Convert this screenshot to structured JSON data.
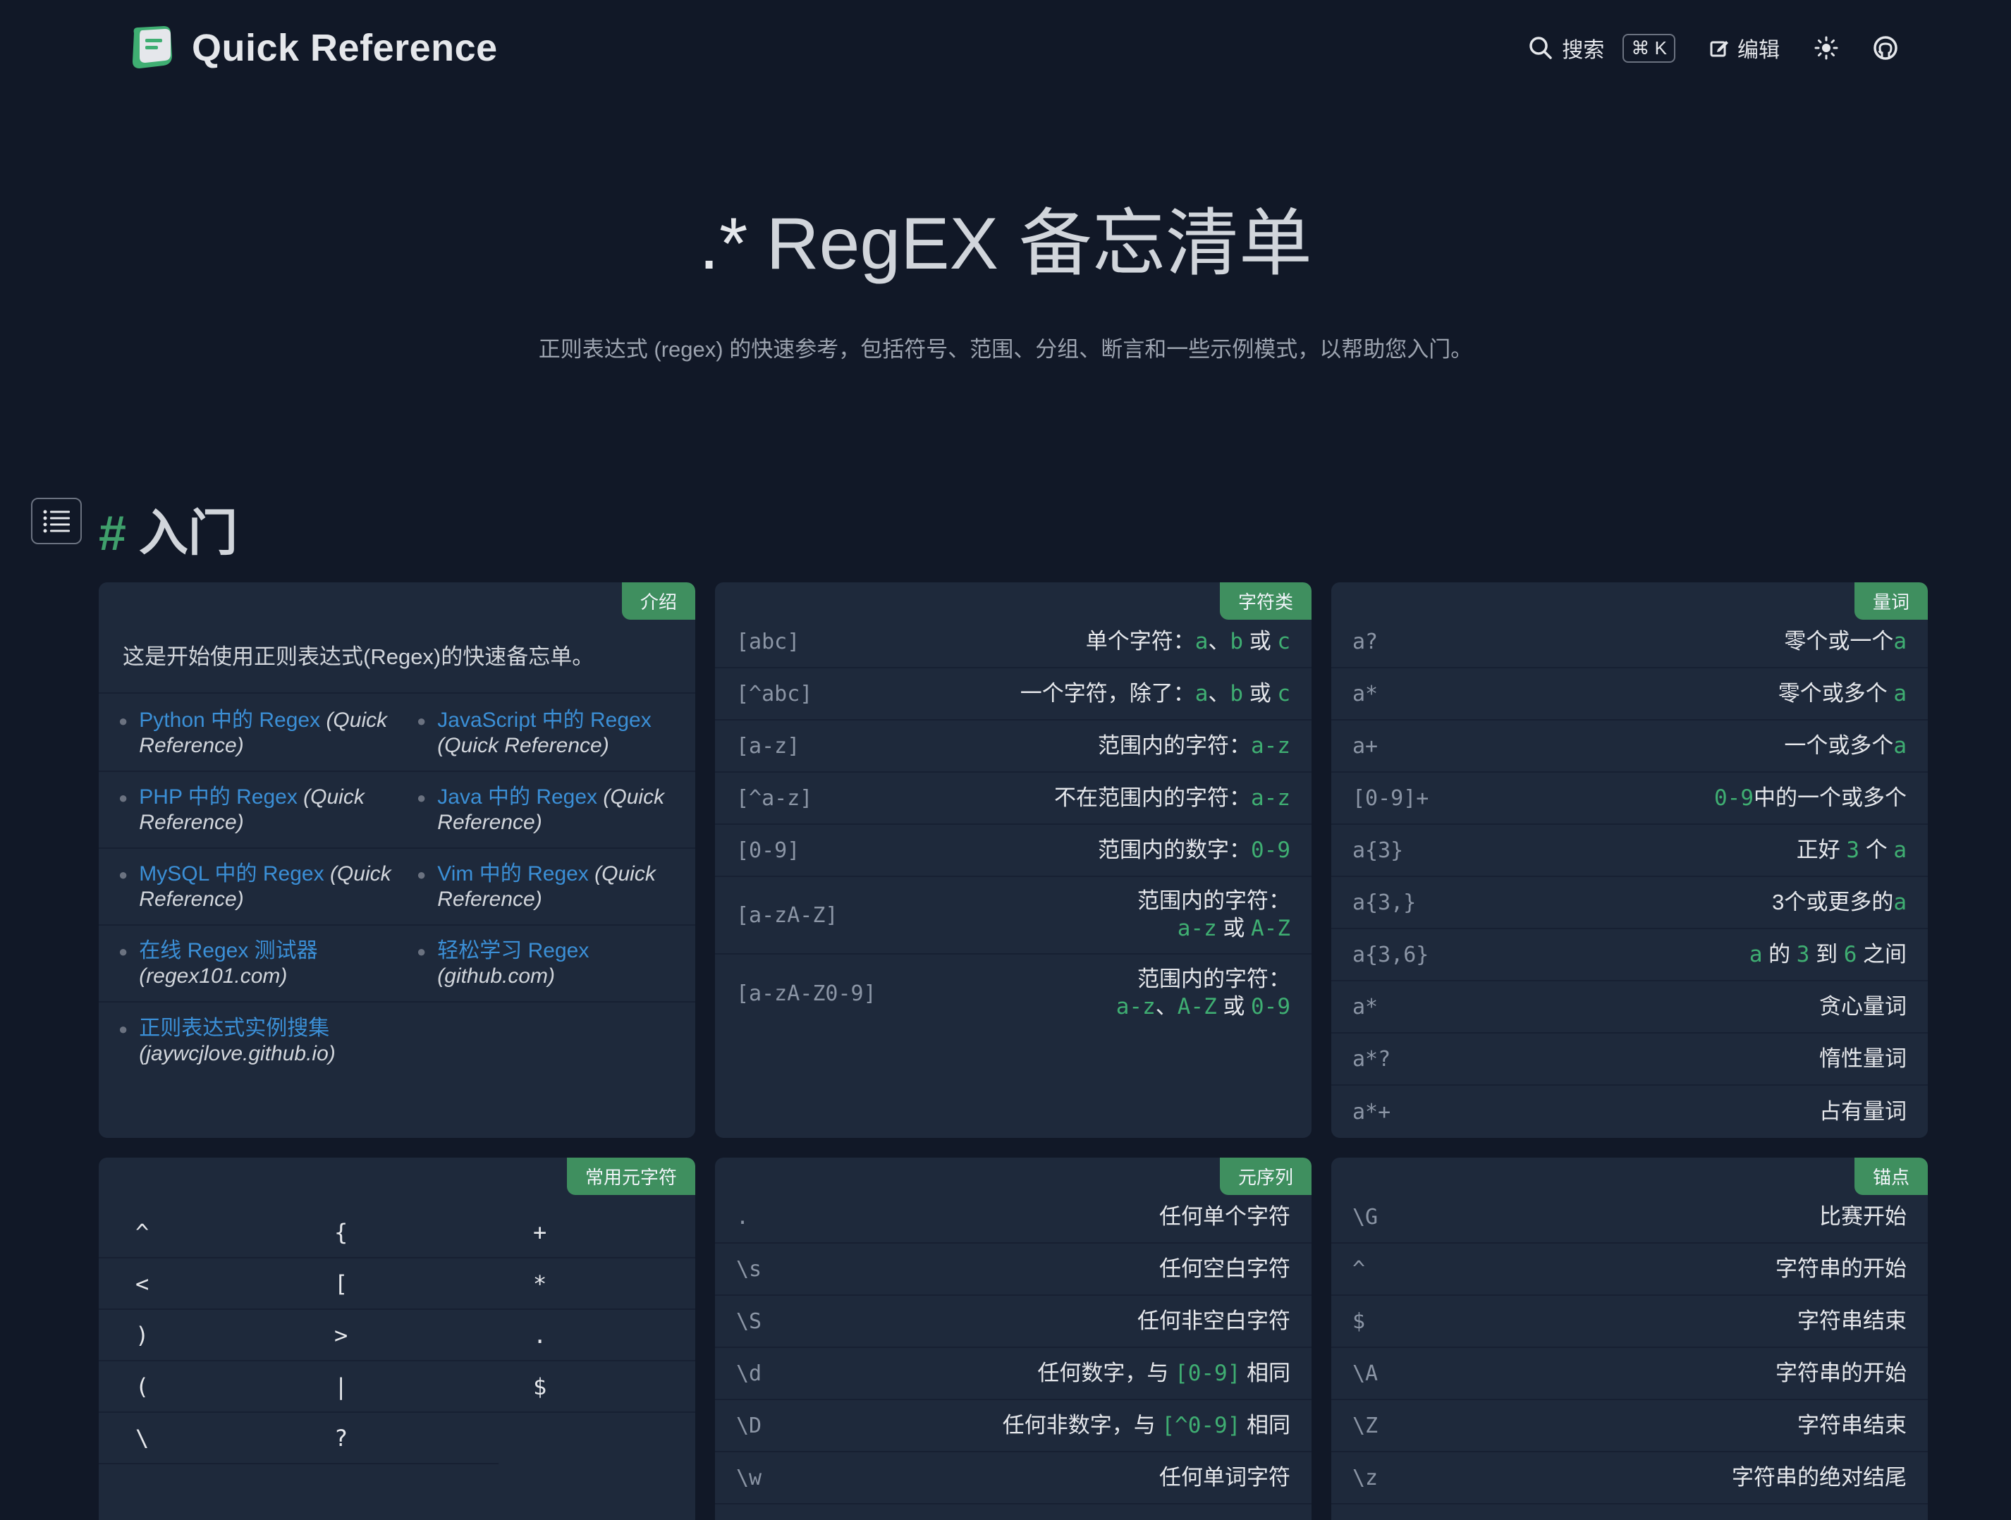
{
  "header": {
    "brand": "Quick Reference",
    "search_label": "搜索",
    "search_shortcut": "⌘ K",
    "edit_label": "编辑"
  },
  "hero": {
    "icon": ".*",
    "title": "RegEX 备忘清单",
    "subtitle": "正则表达式 (regex) 的快速参考，包括符号、范围、分组、断言和一些示例模式，以帮助您入门。"
  },
  "section": {
    "hash": "#",
    "title": "入门"
  },
  "intro": {
    "badge": "介绍",
    "text": "这是开始使用正则表达式(Regex)的快速备忘单。",
    "links": [
      {
        "label": "Python 中的 Regex",
        "note": "(Quick Reference)"
      },
      {
        "label": "JavaScript 中的 Regex",
        "note": "(Quick Reference)"
      },
      {
        "label": "PHP 中的 Regex",
        "note": "(Quick Reference)"
      },
      {
        "label": "Java 中的 Regex",
        "note": "(Quick Reference)"
      },
      {
        "label": "MySQL 中的 Regex",
        "note": "(Quick Reference)"
      },
      {
        "label": "Vim 中的 Regex",
        "note": "(Quick Reference)"
      },
      {
        "label": "在线 Regex 测试器",
        "note": "(regex101.com)"
      },
      {
        "label": "轻松学习 Regex",
        "note": "(github.com)"
      },
      {
        "label": "正则表达式实例搜集",
        "note": "(jaywcjlove.github.io)"
      }
    ]
  },
  "charclass": {
    "badge": "字符类",
    "rows": [
      {
        "code": "[abc]",
        "d1": "单个字符：",
        "g1": "a",
        "d2": "、",
        "g2": "b",
        "d3": " 或 ",
        "g3": "c"
      },
      {
        "code": "[^abc]",
        "d1": "一个字符，除了：",
        "g1": "a",
        "d2": "、",
        "g2": "b",
        "d3": " 或 ",
        "g3": "c"
      },
      {
        "code": "[a-z]",
        "d1": "范围内的字符：",
        "g1": "a-z"
      },
      {
        "code": "[^a-z]",
        "d1": "不在范围内的字符：",
        "g1": "a-z"
      },
      {
        "code": "[0-9]",
        "d1": "范围内的数字：",
        "g1": "0-9"
      },
      {
        "code": "[a-zA-Z]",
        "line1": "范围内的字符：",
        "g1": "a-z",
        "d2": " 或 ",
        "g2": "A-Z"
      },
      {
        "code": "[a-zA-Z0-9]",
        "line1": "范围内的字符：",
        "g1": "a-z",
        "d2": "、",
        "g2": "A-Z",
        "d3": " 或 ",
        "g3": "0-9"
      }
    ]
  },
  "quantifiers": {
    "badge": "量词",
    "rows": [
      {
        "code": "a?",
        "pre": "",
        "desc": "零个或一个",
        "post": "a"
      },
      {
        "code": "a*",
        "pre": "",
        "desc": "零个或多个 ",
        "post": "a"
      },
      {
        "code": "a+",
        "pre": "",
        "desc": "一个或多个",
        "post": "a"
      },
      {
        "code": "[0-9]+",
        "pre": "0-9",
        "desc": "中的一个或多个",
        "post": ""
      },
      {
        "code": "a{3}",
        "pre": "",
        "desc": "正好 ",
        "g": "3",
        "desc2": " 个 ",
        "post": "a"
      },
      {
        "code": "a{3,}",
        "pre": "",
        "desc": "3个或更多的",
        "post": "a"
      },
      {
        "code": "a{3,6}",
        "pre": "a",
        "desc": " 的 ",
        "g": "3",
        "desc2": " 到 ",
        "g2": "6",
        "desc3": " 之间",
        "post": ""
      },
      {
        "code": "a*",
        "pre": "",
        "desc": "贪心量词",
        "post": ""
      },
      {
        "code": "a*?",
        "pre": "",
        "desc": "惰性量词",
        "post": ""
      },
      {
        "code": "a*+",
        "pre": "",
        "desc": "占有量词",
        "post": ""
      }
    ]
  },
  "metachars": {
    "badge": "常用元字符",
    "rows": [
      [
        "^",
        "{",
        "+"
      ],
      [
        "<",
        "[",
        "*"
      ],
      [
        ")",
        ">",
        "."
      ],
      [
        "(",
        "|",
        "$"
      ],
      [
        "\\",
        "?"
      ]
    ]
  },
  "metaseq": {
    "badge": "元序列",
    "rows": [
      {
        "code": ".",
        "desc": "任何单个字符"
      },
      {
        "code": "\\s",
        "desc": "任何空白字符"
      },
      {
        "code": "\\S",
        "desc": "任何非空白字符"
      },
      {
        "code": "\\d",
        "desc": "任何数字，与 ",
        "g": "[0-9]",
        "desc2": " 相同"
      },
      {
        "code": "\\D",
        "desc": "任何非数字，与 ",
        "g": "[^0-9]",
        "desc2": " 相同"
      },
      {
        "code": "\\w",
        "desc": "任何单词字符"
      }
    ]
  },
  "anchors": {
    "badge": "锚点",
    "rows": [
      {
        "code": "\\G",
        "desc": "比赛开始"
      },
      {
        "code": "^",
        "desc": "字符串的开始"
      },
      {
        "code": "$",
        "desc": "字符串结束"
      },
      {
        "code": "\\A",
        "desc": "字符串的开始"
      },
      {
        "code": "\\Z",
        "desc": "字符串结束"
      },
      {
        "code": "\\z",
        "desc": "字符串的绝对结尾"
      }
    ]
  }
}
